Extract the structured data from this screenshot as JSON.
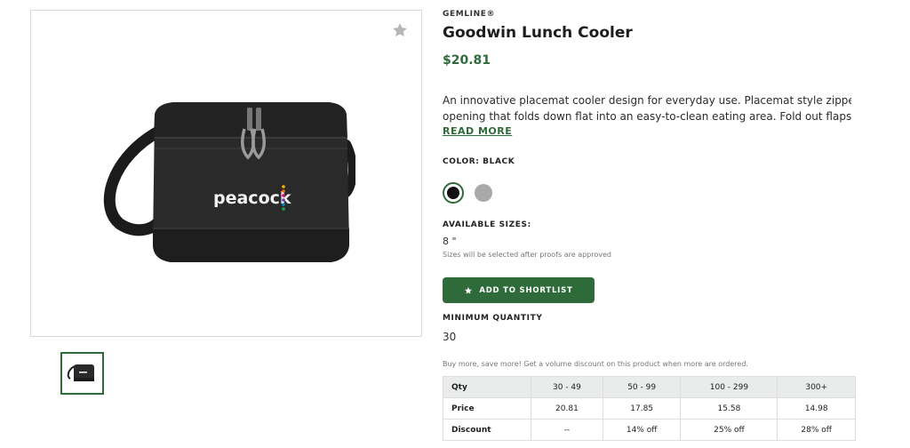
{
  "product": {
    "brand": "GEMLINE®",
    "title": "Goodwin Lunch Cooler",
    "price": "$20.81",
    "description_line1": "An innovative placemat cooler design for everyday use. Placemat style zippered",
    "description_line2": "opening that folds down flat into an easy-to-clean eating area. Fold out flaps with...",
    "read_more": "READ MORE",
    "logo_text": "peacock"
  },
  "color": {
    "label": "COLOR: BLACK",
    "swatches": [
      {
        "name": "Black",
        "hex": "#111111",
        "selected": true
      },
      {
        "name": "Gray",
        "hex": "#a9a9a9",
        "selected": false
      }
    ]
  },
  "sizes": {
    "label": "AVAILABLE SIZES:",
    "value": "8 \"",
    "note": "Sizes will be selected after proofs are approved"
  },
  "actions": {
    "shortlist_label": "ADD TO SHORTLIST"
  },
  "minimum": {
    "label": "MINIMUM QUANTITY",
    "value": "30"
  },
  "volume": {
    "note": "Buy more, save more! Get a volume discount on this product when more are ordered.",
    "headers": [
      "Qty",
      "30 - 49",
      "50 - 99",
      "100 - 299",
      "300+"
    ],
    "rows": [
      [
        "Price",
        "20.81",
        "17.85",
        "15.58",
        "14.98"
      ],
      [
        "Discount",
        "--",
        "14% off",
        "25% off",
        "28% off"
      ]
    ]
  },
  "colors": {
    "accent": "#2f6b3a",
    "table_header_bg": "#e9eceb"
  },
  "icons": {
    "favorite": "star-icon",
    "shortlist": "star-icon"
  }
}
